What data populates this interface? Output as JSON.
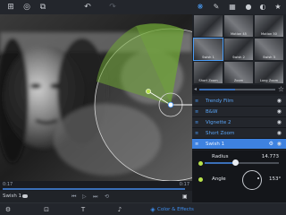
{
  "app": {
    "colors": {
      "accent": "#3f8ff0",
      "selected_row": "#3e82e0",
      "mask_green": "#8cc840"
    }
  },
  "toolbar": {
    "icons": [
      "grid-icon",
      "target-icon",
      "layers-icon",
      "undo-icon",
      "redo-icon"
    ]
  },
  "preview": {
    "time_current": "0:17",
    "time_end": "0:17"
  },
  "transport": {
    "clip_label": "Swish 1"
  },
  "bottombar": {
    "color_effects_label": "Color & Effects"
  },
  "panel": {
    "tabs": [
      "filters-icon",
      "brush-icon",
      "gallery-icon",
      "drop-icon",
      "color-icon",
      "star-icon"
    ],
    "thumbnails": [
      {
        "label": ""
      },
      {
        "label": "Motion 45"
      },
      {
        "label": "Motion 50"
      },
      {
        "label": "Swish 1"
      },
      {
        "label": "Swish 2"
      },
      {
        "label": "Swish 3"
      },
      {
        "label": "Short Zoom"
      },
      {
        "label": "Zoom"
      },
      {
        "label": "Long Zoom"
      }
    ],
    "effects": [
      {
        "name": "Trendy Film"
      },
      {
        "name": "B&W"
      },
      {
        "name": "Vignette 2"
      },
      {
        "name": "Short Zoom"
      },
      {
        "name": "Swish 1"
      }
    ],
    "params": {
      "radius_label": "Radius",
      "radius_value": "14.773",
      "radius_fraction": 0.42,
      "angle_label": "Angle",
      "angle_value": "153°"
    }
  }
}
